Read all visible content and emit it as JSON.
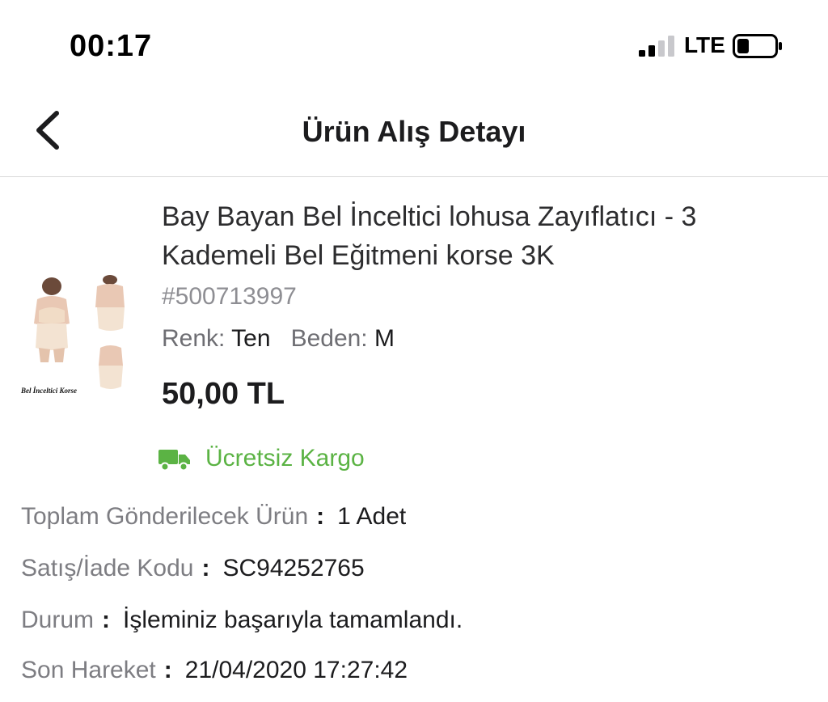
{
  "status_bar": {
    "time": "00:17",
    "network": "LTE",
    "icons": [
      "signal-icon",
      "battery-icon"
    ]
  },
  "nav": {
    "title": "Ürün Alış Detayı",
    "back_icon": "chevron-left-icon"
  },
  "product": {
    "title": "Bay Bayan Bel İnceltici lohusa Zayıflatıcı - 3 Kademeli Bel Eğitmeni korse 3K",
    "id": "#500713997",
    "color_label": "Renk:",
    "color_value": "Ten",
    "size_label": "Beden:",
    "size_value": "M",
    "price": "50,00 TL",
    "image_caption": "Bel İnceltici Korse"
  },
  "shipping": {
    "icon": "truck-icon",
    "text": "Ücretsiz Kargo",
    "color": "#5bb344"
  },
  "details": [
    {
      "label": "Toplam Gönderilecek Ürün",
      "value": "1 Adet"
    },
    {
      "label": "Satış/İade Kodu",
      "value": "SC94252765"
    },
    {
      "label": "Durum",
      "value": "İşleminiz başarıyla tamamlandı."
    },
    {
      "label": "Son Hareket",
      "value": "21/04/2020 17:27:42"
    }
  ],
  "separator": ":"
}
